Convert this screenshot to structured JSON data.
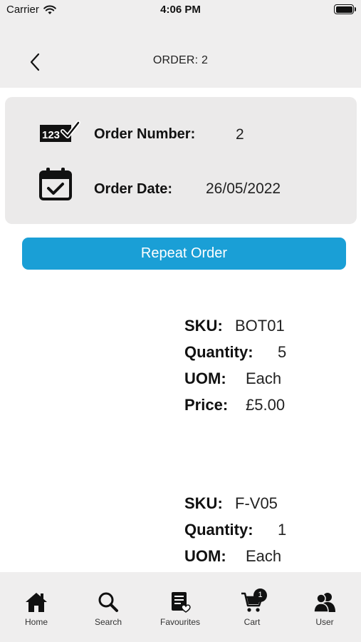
{
  "status_bar": {
    "carrier": "Carrier",
    "time": "4:06 PM"
  },
  "nav": {
    "title": "ORDER: 2"
  },
  "order": {
    "number_label": "Order Number:",
    "number_value": "2",
    "date_label": "Order Date:",
    "date_value": "26/05/2022",
    "number_icon_digits": "123"
  },
  "repeat_button": {
    "label": "Repeat Order"
  },
  "items": [
    {
      "sku_label": "SKU:",
      "sku": "BOT01",
      "qty_label": "Quantity:",
      "qty": "5",
      "uom_label": "UOM:",
      "uom": "Each",
      "price_label": "Price:",
      "price": "£5.00"
    },
    {
      "sku_label": "SKU:",
      "sku": "F-V05",
      "qty_label": "Quantity:",
      "qty": "1",
      "uom_label": "UOM:",
      "uom": "Each"
    }
  ],
  "tabs": [
    {
      "label": "Home",
      "icon": "home-icon"
    },
    {
      "label": "Search",
      "icon": "search-icon"
    },
    {
      "label": "Favourites",
      "icon": "favourites-icon"
    },
    {
      "label": "Cart",
      "icon": "cart-icon",
      "badge": "1"
    },
    {
      "label": "User",
      "icon": "user-icon"
    }
  ],
  "colors": {
    "accent": "#1a9fd6",
    "header_bg": "#efeeee",
    "card_bg": "#ebeaea"
  }
}
